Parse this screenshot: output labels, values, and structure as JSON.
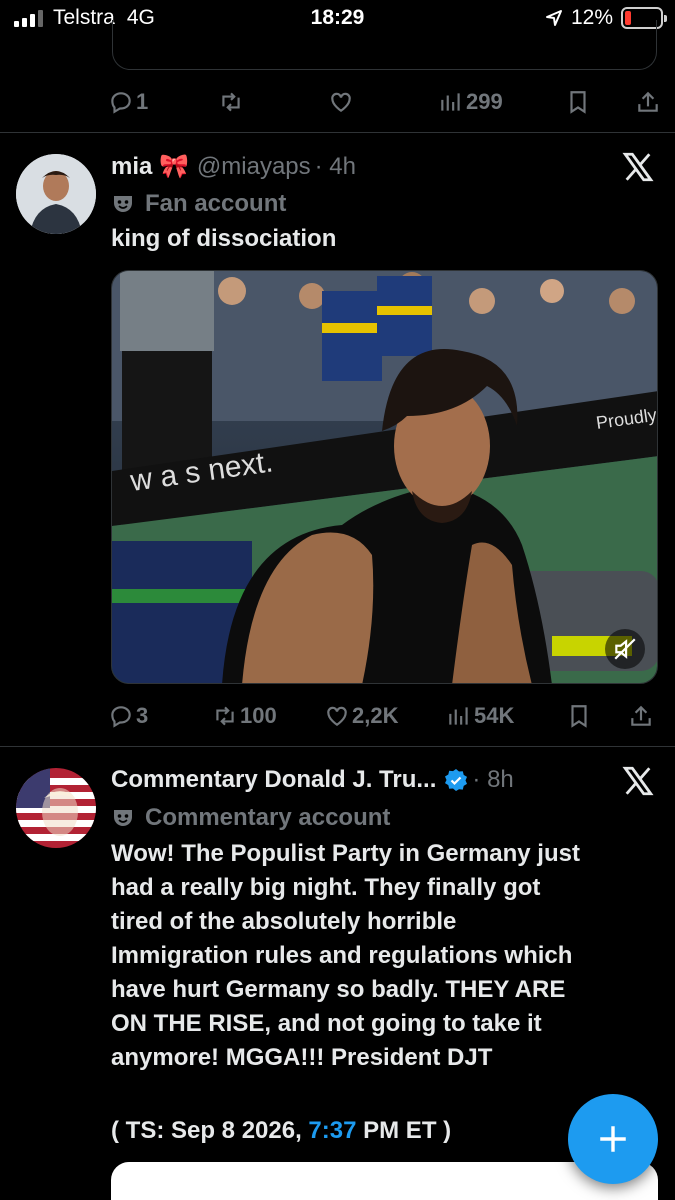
{
  "status_bar": {
    "carrier": "Telstra",
    "network": "4G",
    "time": "18:29",
    "battery": "12%"
  },
  "top_tweet": {
    "actions": {
      "replies": "1",
      "retweets": "",
      "likes": "",
      "views": "299"
    }
  },
  "tweet1": {
    "name": "mia 🎀",
    "handle": "@miayaps",
    "time": "· 4h",
    "label": "Fan account",
    "text": "king of dissociation",
    "media_text": "w  a  s next.",
    "media_sign": "Proudly",
    "actions": {
      "replies": "3",
      "retweets": "100",
      "likes": "2,2K",
      "views": "54K"
    }
  },
  "tweet2": {
    "name": "Commentary Donald J. Tru...",
    "time": "· 8h",
    "label": "Commentary account",
    "lines": [
      "Wow! The Populist Party in Germany just",
      "had a really big night. They finally got",
      "tired of the absolutely horrible",
      "Immigration rules and regulations which",
      "have hurt Germany so badly. THEY ARE",
      "ON THE RISE, and not going to take it",
      "anymore! MGGA!!! President DJT"
    ],
    "ts_prefix": "( TS: Sep 8 2026, ",
    "ts_link": "7:37",
    "ts_suffix": " PM ET )"
  },
  "colors": {
    "accent": "#1d9bf0",
    "background": "#000000",
    "muted": "#71767b"
  }
}
